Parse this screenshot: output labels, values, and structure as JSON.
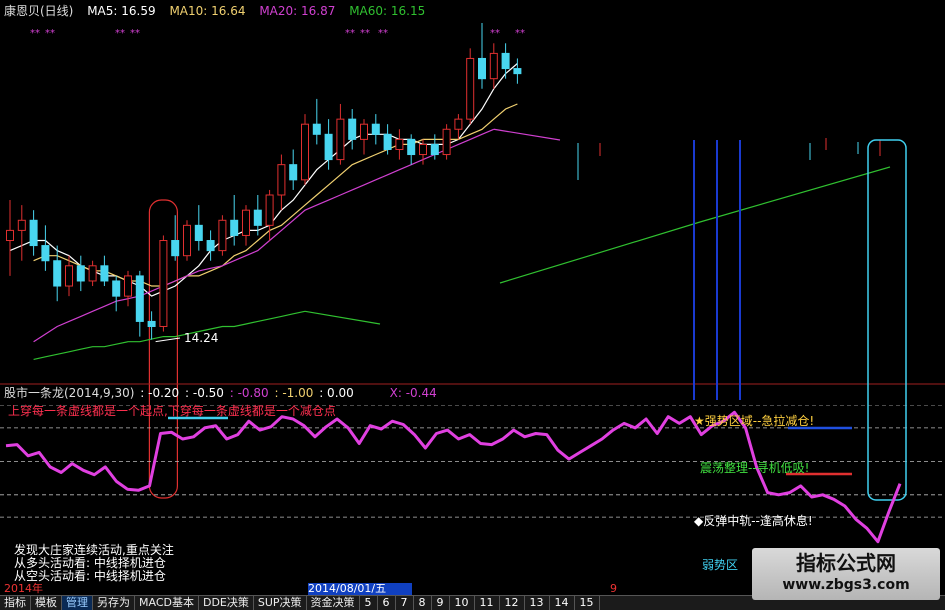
{
  "legend": {
    "title": "康恩贝(日线)",
    "ma5": "MA5: 16.59",
    "ma10": "MA10: 16.64",
    "ma20": "MA20: 16.87",
    "ma60": "MA60: 16.15"
  },
  "price_low_label": "14.24",
  "indicator_header": {
    "name": "股市一条龙(2014,9,30)",
    "v1": ": -0.20",
    "v2": ": -0.50",
    "v3": ": -0.80",
    "v4": ": -1.00",
    "v5": ": 0.00",
    "v6": "X: -0.44"
  },
  "annotations": {
    "rule": "上穿每一条虚线都是一个起点,下穿每一条虚线都是一个减仓点",
    "strong": "强势区域--急拉减仓!",
    "oscillate": "震荡整理--寻机低吸!",
    "rebound": "◆反弹中轨--逢高休息!",
    "weak": "弱势区"
  },
  "bottom_notes": {
    "line1": "发现大庄家连续活动,重点关注",
    "line2": "从多头活动看: 中线择机进仓",
    "line3": "从空头活动看: 中线择机进仓"
  },
  "year_label": "2014年",
  "date_label": "2014/08/01/五",
  "date_right": "9",
  "tabs": [
    "指标",
    "模板",
    "管理",
    "另存为",
    "MACD基本",
    "DDE决策",
    "SUP决策",
    "资金决策",
    "5",
    "6",
    "7",
    "8",
    "9",
    "10",
    "11",
    "12",
    "13",
    "14",
    "15"
  ],
  "watermark": {
    "line1": "指标公式网",
    "line2": "www.zbgs3.com"
  },
  "colors": {
    "up": "#e03030",
    "down": "#49d6f0",
    "ma5": "#ffffff",
    "ma10": "#f0d070",
    "ma20": "#d040d0",
    "ma60": "#30c030",
    "indicator": "#e040e0",
    "annot_red": "#ff3050",
    "annot_yellow": "#ffd040",
    "annot_green": "#40e040",
    "annot_white": "#ffffff",
    "annot_cyan": "#40d0f0"
  },
  "chart_data": [
    {
      "type": "candlestick",
      "title": "康恩贝(日线)",
      "ylim": [
        13.6,
        20.6
      ],
      "candles": [
        {
          "o": 16.2,
          "h": 17.0,
          "l": 15.5,
          "c": 16.4
        },
        {
          "o": 16.4,
          "h": 16.9,
          "l": 15.8,
          "c": 16.6
        },
        {
          "o": 16.6,
          "h": 16.8,
          "l": 15.9,
          "c": 16.1
        },
        {
          "o": 16.1,
          "h": 16.5,
          "l": 15.6,
          "c": 15.8
        },
        {
          "o": 15.8,
          "h": 16.1,
          "l": 15.0,
          "c": 15.3
        },
        {
          "o": 15.3,
          "h": 15.9,
          "l": 15.1,
          "c": 15.7
        },
        {
          "o": 15.7,
          "h": 15.9,
          "l": 15.2,
          "c": 15.4
        },
        {
          "o": 15.4,
          "h": 15.8,
          "l": 15.3,
          "c": 15.7
        },
        {
          "o": 15.7,
          "h": 15.9,
          "l": 15.3,
          "c": 15.4
        },
        {
          "o": 15.4,
          "h": 15.5,
          "l": 14.8,
          "c": 15.1
        },
        {
          "o": 15.1,
          "h": 15.6,
          "l": 14.9,
          "c": 15.5
        },
        {
          "o": 15.5,
          "h": 15.6,
          "l": 14.3,
          "c": 14.6
        },
        {
          "o": 14.6,
          "h": 14.8,
          "l": 14.24,
          "c": 14.5
        },
        {
          "o": 14.5,
          "h": 16.3,
          "l": 14.4,
          "c": 16.2
        },
        {
          "o": 16.2,
          "h": 16.7,
          "l": 15.8,
          "c": 15.9
        },
        {
          "o": 15.9,
          "h": 16.6,
          "l": 15.8,
          "c": 16.5
        },
        {
          "o": 16.5,
          "h": 16.9,
          "l": 16.0,
          "c": 16.2
        },
        {
          "o": 16.2,
          "h": 16.4,
          "l": 15.8,
          "c": 16.0
        },
        {
          "o": 16.0,
          "h": 16.7,
          "l": 15.9,
          "c": 16.6
        },
        {
          "o": 16.6,
          "h": 17.1,
          "l": 16.1,
          "c": 16.3
        },
        {
          "o": 16.3,
          "h": 16.9,
          "l": 16.1,
          "c": 16.8
        },
        {
          "o": 16.8,
          "h": 17.1,
          "l": 16.3,
          "c": 16.5
        },
        {
          "o": 16.5,
          "h": 17.2,
          "l": 16.2,
          "c": 17.1
        },
        {
          "o": 17.1,
          "h": 17.9,
          "l": 16.8,
          "c": 17.7
        },
        {
          "o": 17.7,
          "h": 18.0,
          "l": 17.2,
          "c": 17.4
        },
        {
          "o": 17.4,
          "h": 18.7,
          "l": 17.3,
          "c": 18.5
        },
        {
          "o": 18.5,
          "h": 19.0,
          "l": 18.1,
          "c": 18.3
        },
        {
          "o": 18.3,
          "h": 18.6,
          "l": 17.6,
          "c": 17.8
        },
        {
          "o": 17.8,
          "h": 18.9,
          "l": 17.7,
          "c": 18.6
        },
        {
          "o": 18.6,
          "h": 18.8,
          "l": 18.0,
          "c": 18.2
        },
        {
          "o": 18.2,
          "h": 18.6,
          "l": 17.9,
          "c": 18.5
        },
        {
          "o": 18.5,
          "h": 18.7,
          "l": 18.1,
          "c": 18.3
        },
        {
          "o": 18.3,
          "h": 18.5,
          "l": 17.9,
          "c": 18.0
        },
        {
          "o": 18.0,
          "h": 18.4,
          "l": 17.8,
          "c": 18.2
        },
        {
          "o": 18.2,
          "h": 18.3,
          "l": 17.7,
          "c": 17.9
        },
        {
          "o": 17.9,
          "h": 18.2,
          "l": 17.7,
          "c": 18.1
        },
        {
          "o": 18.1,
          "h": 18.3,
          "l": 17.8,
          "c": 17.9
        },
        {
          "o": 17.9,
          "h": 18.5,
          "l": 17.8,
          "c": 18.4
        },
        {
          "o": 18.4,
          "h": 18.7,
          "l": 18.2,
          "c": 18.6
        },
        {
          "o": 18.6,
          "h": 20.0,
          "l": 18.5,
          "c": 19.8
        },
        {
          "o": 19.8,
          "h": 20.5,
          "l": 19.2,
          "c": 19.4
        },
        {
          "o": 19.4,
          "h": 20.1,
          "l": 19.2,
          "c": 19.9
        },
        {
          "o": 19.9,
          "h": 20.1,
          "l": 19.4,
          "c": 19.6
        },
        {
          "o": 19.6,
          "h": 19.8,
          "l": 19.3,
          "c": 19.5
        }
      ],
      "ma": [
        {
          "name": "MA5",
          "values": [
            16.0,
            16.1,
            16.2,
            16.2,
            16.0,
            15.9,
            15.7,
            15.6,
            15.5,
            15.5,
            15.4,
            15.3,
            15.1,
            15.2,
            15.3,
            15.5,
            15.7,
            16.0,
            16.2,
            16.3,
            16.4,
            16.4,
            16.5,
            16.8,
            17.0,
            17.3,
            17.6,
            17.8,
            18.0,
            18.2,
            18.3,
            18.3,
            18.3,
            18.2,
            18.2,
            18.1,
            18.1,
            18.1,
            18.2,
            18.5,
            18.8,
            19.2,
            19.5,
            19.7
          ]
        },
        {
          "name": "MA10",
          "values": [
            null,
            null,
            15.8,
            15.9,
            15.9,
            15.8,
            15.7,
            15.6,
            15.6,
            15.5,
            15.4,
            15.4,
            15.3,
            15.3,
            15.4,
            15.5,
            15.5,
            15.6,
            15.7,
            15.9,
            16.0,
            16.2,
            16.4,
            16.5,
            16.7,
            16.9,
            17.1,
            17.3,
            17.5,
            17.7,
            17.8,
            17.9,
            18.0,
            18.1,
            18.1,
            18.2,
            18.2,
            18.2,
            18.2,
            18.3,
            18.4,
            18.6,
            18.8,
            18.9
          ]
        },
        {
          "name": "MA20",
          "values": [
            null,
            null,
            14.2,
            14.35,
            14.5,
            14.6,
            14.7,
            14.8,
            14.9,
            15.0,
            15.05,
            15.1,
            15.2,
            15.3,
            15.4,
            15.5,
            15.6,
            15.65,
            15.7,
            15.8,
            15.9,
            16.0,
            16.2,
            16.4,
            16.6,
            16.8,
            16.9,
            17.0,
            17.1,
            17.2,
            17.3,
            17.4,
            17.5,
            17.6,
            17.7,
            17.8,
            17.9,
            18.0,
            18.1,
            18.2,
            18.3,
            18.4,
            null,
            null
          ]
        },
        {
          "name": "MA60",
          "values": [
            null,
            null,
            13.85,
            13.9,
            13.95,
            14.0,
            14.05,
            14.1,
            14.1,
            14.15,
            14.2,
            14.2,
            14.25,
            14.3,
            14.3,
            14.35,
            14.4,
            14.45,
            14.5,
            14.5,
            14.55,
            14.6,
            14.65,
            14.7,
            14.75,
            14.8,
            null,
            null,
            null,
            null,
            null,
            null,
            null,
            null,
            null,
            null,
            null,
            null,
            null,
            null,
            null,
            null,
            null,
            null
          ]
        }
      ]
    },
    {
      "type": "line",
      "title": "股市一条龙(2014,9,30)",
      "levels": [
        -0.2,
        -0.5,
        -0.8,
        -1.0,
        0.0
      ],
      "ylim": [
        -1.25,
        0.05
      ],
      "series": [
        {
          "name": "X",
          "values": [
            -0.36,
            -0.35,
            -0.45,
            -0.42,
            -0.55,
            -0.6,
            -0.52,
            -0.58,
            -0.62,
            -0.55,
            -0.68,
            -0.75,
            -0.76,
            -0.72,
            -0.25,
            -0.24,
            -0.3,
            -0.28,
            -0.2,
            -0.18,
            -0.3,
            -0.26,
            -0.14,
            -0.22,
            -0.19,
            -0.1,
            -0.12,
            -0.18,
            -0.28,
            -0.19,
            -0.12,
            -0.2,
            -0.34,
            -0.18,
            -0.21,
            -0.14,
            -0.17,
            -0.26,
            -0.38,
            -0.25,
            -0.22,
            -0.3,
            -0.26,
            -0.34,
            -0.35,
            -0.3,
            -0.22,
            -0.28,
            -0.25,
            -0.26,
            -0.4,
            -0.48,
            -0.42,
            -0.36,
            -0.3,
            -0.22,
            -0.16,
            -0.2,
            -0.12,
            -0.25,
            -0.1,
            -0.16,
            -0.1,
            -0.26,
            -0.18,
            -0.14,
            -0.06,
            -0.2,
            -0.55,
            -0.78,
            -0.8,
            -0.78,
            -0.72,
            -0.82,
            -0.8,
            -0.84,
            -0.9,
            -1.02,
            -1.1,
            -1.22,
            -0.95,
            -0.7
          ]
        }
      ]
    }
  ]
}
